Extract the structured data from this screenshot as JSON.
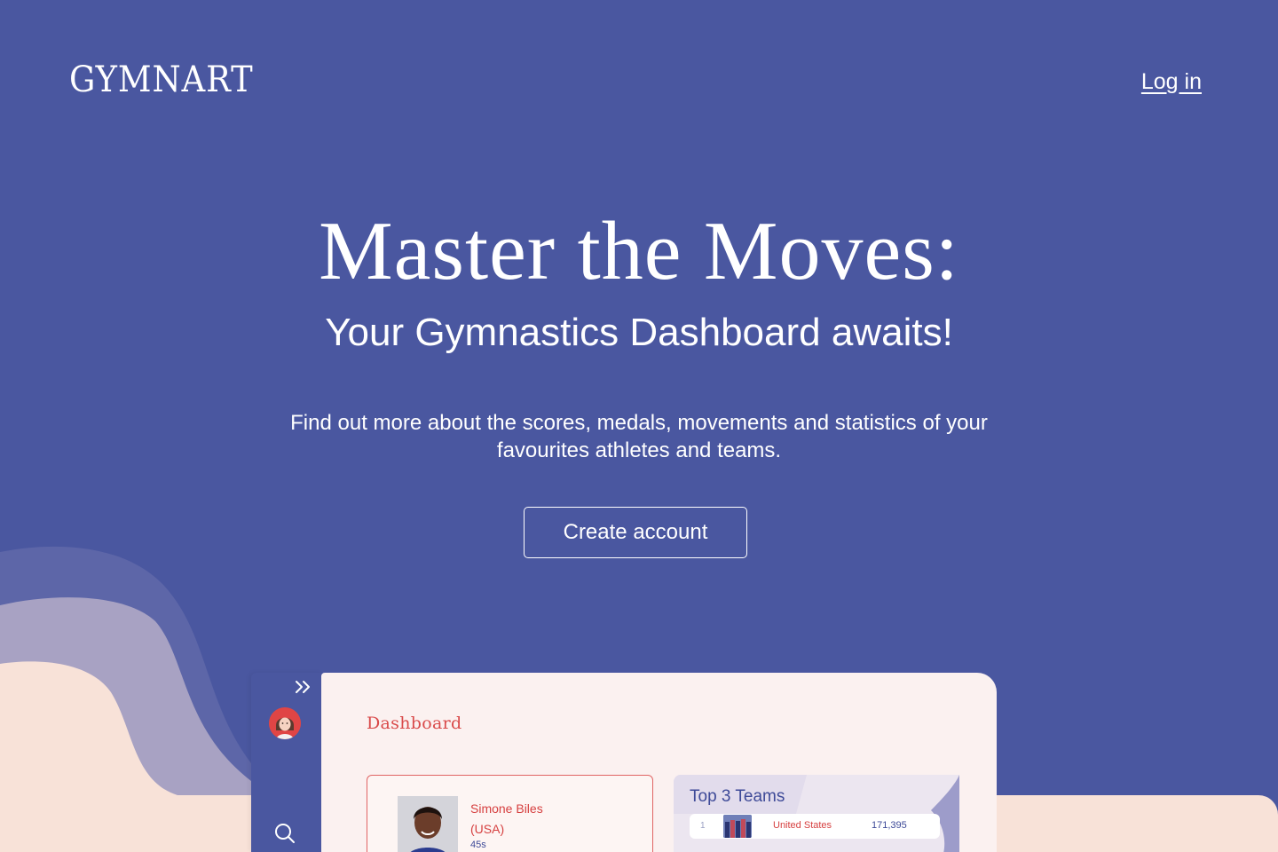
{
  "header": {
    "logo": "GYMNART",
    "login_label": "Log in"
  },
  "hero": {
    "title": "Master the Moves:",
    "subtitle": "Your Gymnastics Dashboard awaits!",
    "description": "Find out more about the scores, medals, movements and statistics of your favourites athletes and teams.",
    "cta_label": "Create account"
  },
  "colors": {
    "background": "#4a57a0",
    "accent_red": "#d94a4a",
    "peach": "#f8e2d8",
    "lavender": "#a8a2c3"
  },
  "preview": {
    "icons": [
      "expand-icon",
      "avatar",
      "search-icon"
    ],
    "dashboard_title": "Dashboard",
    "athlete": {
      "name_line1": "Simone Biles",
      "name_line2": "(USA)",
      "detail": "45s"
    },
    "teams": {
      "title": "Top 3 Teams",
      "rows": [
        {
          "rank": "1",
          "name": "United States",
          "score": "171,395"
        }
      ]
    }
  }
}
